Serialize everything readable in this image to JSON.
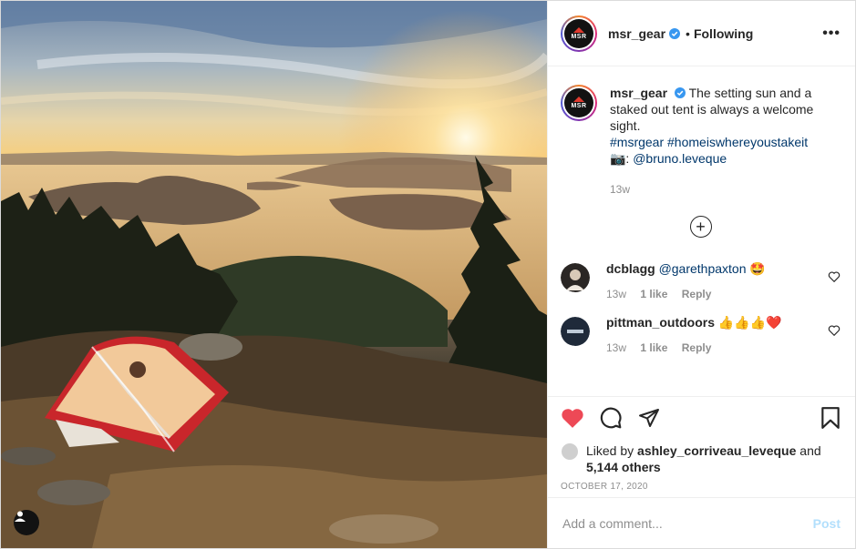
{
  "header": {
    "username": "msr_gear",
    "separator": "•",
    "follow_status": "Following",
    "more_glyph": "•••",
    "avatar_text": "MSR"
  },
  "caption": {
    "username": "msr_gear",
    "text": "The setting sun and a staked out tent is always a welcome sight.",
    "hashtags": "#msrgear #homeiswhereyoustakeit",
    "credit_prefix": "📷:",
    "credit_handle": "@bruno.leveque",
    "time": "13w"
  },
  "load_more_glyph": "+",
  "comments": [
    {
      "username": "dcblagg",
      "mention": "@garethpaxton",
      "emoji": "🤩",
      "time": "13w",
      "likes": "1 like",
      "reply": "Reply"
    },
    {
      "username": "pittman_outdoors",
      "emoji": "👍👍👍❤️",
      "time": "13w",
      "likes": "1 like",
      "reply": "Reply"
    }
  ],
  "likes": {
    "prefix": "Liked by",
    "user": "ashley_corriveau_leveque",
    "joiner": "and",
    "others": "5,144 others"
  },
  "date": "OCTOBER 17, 2020",
  "add_comment": {
    "placeholder": "Add a comment...",
    "post_label": "Post"
  },
  "colors": {
    "heart_red": "#ed4956",
    "verified_blue": "#3897f0",
    "link_blue": "#00376b",
    "post_disabled": "#b2dffc"
  },
  "icons": [
    "user-tag-icon",
    "verified-badge-icon",
    "more-options-icon",
    "load-more-icon",
    "comment-heart-icon",
    "like-heart-icon",
    "comment-icon",
    "share-icon",
    "bookmark-icon"
  ]
}
